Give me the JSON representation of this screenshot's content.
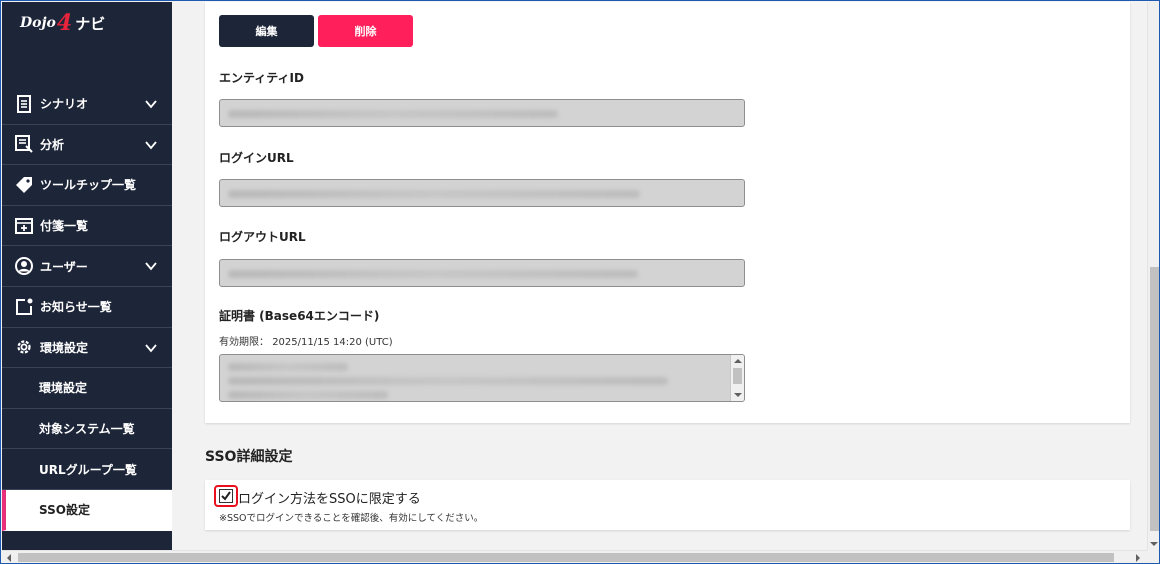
{
  "logo": {
    "part1": "Dojo",
    "part2": "4",
    "part3": "ナビ"
  },
  "sidebar": {
    "items": [
      {
        "label": "シナリオ",
        "icon": "document-icon",
        "expandable": true
      },
      {
        "label": "分析",
        "icon": "report-icon",
        "expandable": true
      },
      {
        "label": "ツールチップ一覧",
        "icon": "tag-icon",
        "expandable": false
      },
      {
        "label": "付箋一覧",
        "icon": "sticky-note-icon",
        "expandable": false
      },
      {
        "label": "ユーザー",
        "icon": "user-icon",
        "expandable": true
      },
      {
        "label": "お知らせ一覧",
        "icon": "notification-icon",
        "expandable": false
      },
      {
        "label": "環境設定",
        "icon": "gear-icon",
        "expandable": true
      }
    ],
    "subitems": [
      {
        "label": "環境設定"
      },
      {
        "label": "対象システム一覧"
      },
      {
        "label": "URLグループ一覧"
      },
      {
        "label": "SSO設定",
        "active": true
      }
    ]
  },
  "buttons": {
    "edit": "編集",
    "delete": "削除"
  },
  "fields": {
    "entity_id_label": "エンティティID",
    "login_url_label": "ログインURL",
    "logout_url_label": "ログアウトURL",
    "certificate_label": "証明書 (Base64エンコード)",
    "expiry_label": "有効期限：",
    "expiry_value": "2025/11/15 14:20 (UTC)"
  },
  "sso_section": {
    "title": "SSO詳細設定",
    "checkbox_label": "ログイン方法をSSOに限定する",
    "checkbox_checked": true,
    "note": "※SSOでログインできることを確認後、有効にしてください。"
  },
  "colors": {
    "sidebar_bg": "#1d2538",
    "active_accent": "#e8307a",
    "delete_button": "#ff1f5a",
    "highlight_border": "#e8101c"
  }
}
